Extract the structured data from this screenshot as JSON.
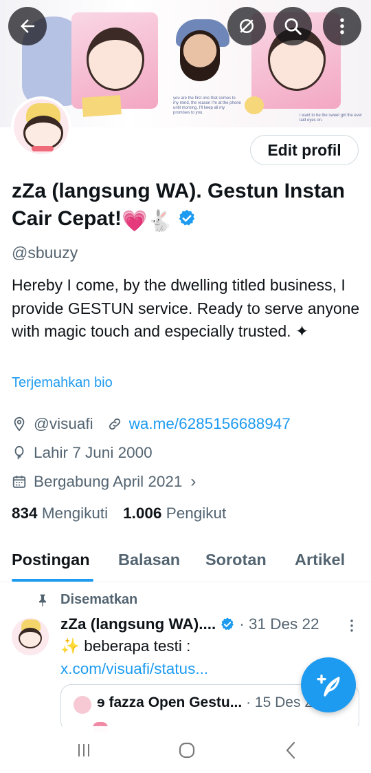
{
  "top_actions": {
    "back_icon": "arrow-left-icon",
    "hide_icon": "eye-slash-icon",
    "search_icon": "search-icon",
    "more_icon": "more-vertical-icon"
  },
  "banner": {
    "caption_left": "you are the first one that comes to my mind, the reason I'm at the phone until morning. I'll keep all my promises to you.",
    "caption_right": "i want to be the sweet girl the ever laid eyes on."
  },
  "profile": {
    "edit_label": "Edit profil",
    "name": "zZa (langsung WA). Gestun Instan Cair Cepat!",
    "name_emojis": "💗🐇",
    "handle": "@sbuuzy",
    "bio": "Hereby I come, by the dwelling titled business, I provide GESTUN service. Ready to serve anyone with magic touch and especially trusted. ✦",
    "translate_label": "Terjemahkan bio",
    "location": "@visuafi",
    "website": "wa.me/6285156688947",
    "birthday": "Lahir 7 Juni 2000",
    "joined": "Bergabung April 2021",
    "following_count": "834",
    "following_label": "Mengikuti",
    "followers_count": "1.006",
    "followers_label": "Pengikut"
  },
  "tabs": [
    {
      "label": "Postingan",
      "active": true
    },
    {
      "label": "Balasan",
      "active": false
    },
    {
      "label": "Sorotan",
      "active": false
    },
    {
      "label": "Artikel",
      "active": false
    }
  ],
  "pinned_tweet": {
    "pinned_label": "Disematkan",
    "author": "zZa (langsung WA)....",
    "date": "· 31 Des 22",
    "text_prefix": "✨ beberapa testi : ",
    "link": "x.com/visuafi/status...",
    "quote_author": "ɘ fazza Open Gestu...",
    "quote_date": "· 15 Des 22"
  },
  "colors": {
    "accent": "#1d9bf0",
    "text_primary": "#0f1419",
    "text_secondary": "#536471",
    "verified": "#1d9bf0"
  },
  "fab_icon": "compose-feather-icon",
  "system_nav": {
    "recents_icon": "recents-icon",
    "home_icon": "home-icon",
    "back_icon": "back-chevron-icon"
  }
}
